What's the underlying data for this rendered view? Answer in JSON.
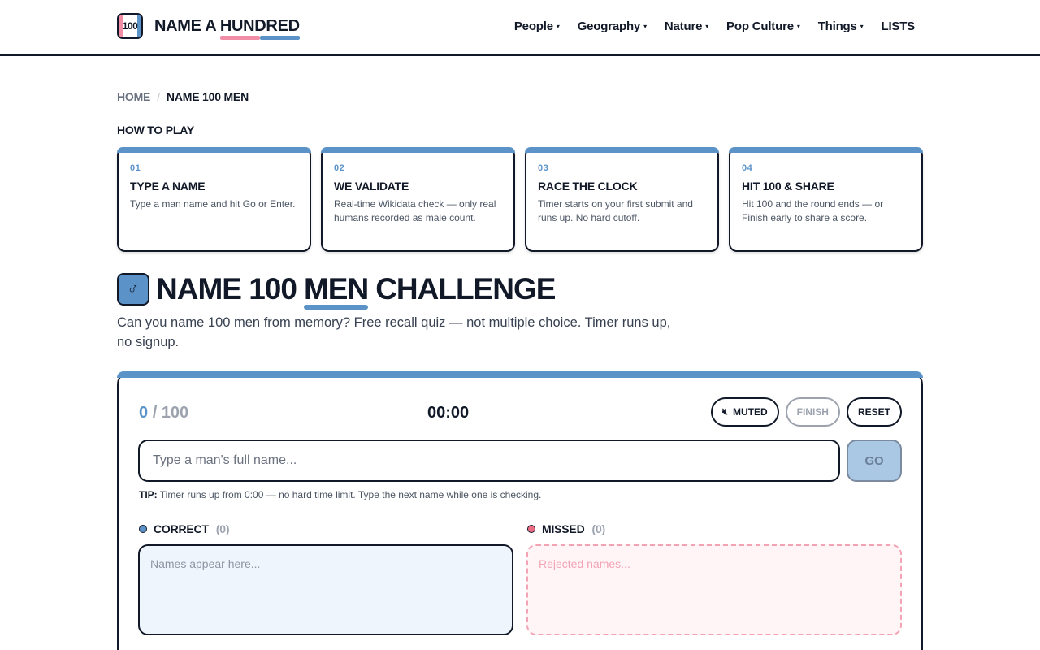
{
  "header": {
    "logo_badge": "100",
    "logo_prefix": "NAME A ",
    "logo_highlight": "HUNDRED",
    "nav": [
      {
        "label": "People",
        "caret": "▾"
      },
      {
        "label": "Geography",
        "caret": "▾"
      },
      {
        "label": "Nature",
        "caret": "▾"
      },
      {
        "label": "Pop Culture",
        "caret": "▾"
      },
      {
        "label": "Things",
        "caret": "▾"
      },
      {
        "label": "LISTS",
        "caret": ""
      }
    ]
  },
  "breadcrumb": {
    "home": "HOME",
    "separator": "/",
    "current": "NAME 100 MEN"
  },
  "how_to_play": {
    "heading": "HOW TO PLAY",
    "steps": [
      {
        "num": "01",
        "title": "TYPE A NAME",
        "desc": "Type a man name and hit Go or Enter."
      },
      {
        "num": "02",
        "title": "WE VALIDATE",
        "desc": "Real-time Wikidata check — only real humans recorded as male count."
      },
      {
        "num": "03",
        "title": "RACE THE CLOCK",
        "desc": "Timer starts on your first submit and runs up. No hard cutoff."
      },
      {
        "num": "04",
        "title": "HIT 100 & SHARE",
        "desc": "Hit 100 and the round ends — or Finish early to share a score."
      }
    ]
  },
  "title": {
    "icon": "♂",
    "icon_name": "male-symbol-icon",
    "part1": "NAME 100",
    "accent": "MEN",
    "part2": "CHALLENGE"
  },
  "subtitle": "Can you name 100 men from memory? Free recall quiz — not multiple choice. Timer runs up, no signup.",
  "game": {
    "score_current": "0",
    "score_sep": "/",
    "score_total": "100",
    "timer": "00:00",
    "mute_icon": "🔇︎",
    "mute_label": "MUTED",
    "finish_label": "FINISH",
    "reset_label": "RESET",
    "input_placeholder": "Type a man's full name...",
    "input_value": "",
    "go_label": "GO",
    "tip_label": "TIP:",
    "tip_text": "Timer runs up from 0:00 — no hard time limit. Type the next name while one is checking.",
    "correct": {
      "label": "CORRECT",
      "count": "(0)",
      "placeholder": "Names appear here...",
      "color": "#5b93c9"
    },
    "missed": {
      "label": "MISSED",
      "count": "(0)",
      "placeholder": "Rejected names...",
      "color": "#ee6b84"
    }
  },
  "colors": {
    "accent_blue": "#5b93c9",
    "accent_pink": "#f28da6",
    "ink": "#111827"
  }
}
